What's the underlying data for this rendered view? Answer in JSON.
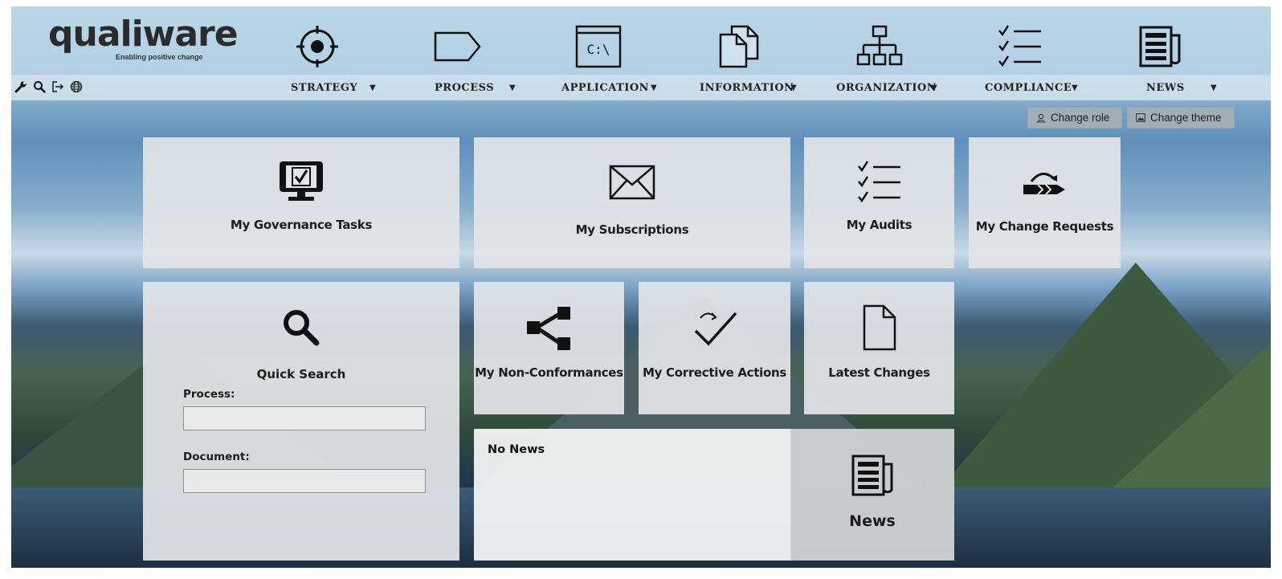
{
  "brand": {
    "name": "qualiware",
    "tagline": "Enabling positive change"
  },
  "toolbar": {
    "icons": [
      "wrench-icon",
      "search-icon",
      "logout-icon",
      "globe-icon"
    ]
  },
  "nav": [
    {
      "label": "STRATEGY",
      "icon": "target-icon"
    },
    {
      "label": "PROCESS",
      "icon": "process-tag-icon"
    },
    {
      "label": "APPLICATION",
      "icon": "terminal-window-icon"
    },
    {
      "label": "INFORMATION",
      "icon": "documents-icon"
    },
    {
      "label": "ORGANIZATION",
      "icon": "org-chart-icon"
    },
    {
      "label": "COMPLIANCE",
      "icon": "checklist-icon"
    },
    {
      "label": "NEWS",
      "icon": "newspaper-icon"
    }
  ],
  "application_icon_text": "C:\\",
  "header_buttons": {
    "change_role": "Change role",
    "change_theme": "Change theme"
  },
  "tiles": {
    "governance": "My Governance Tasks",
    "subscriptions": "My Subscriptions",
    "audits": "My Audits",
    "change_requests": "My Change Requests",
    "non_conformances": "My Non-Conformances",
    "corrective_actions": "My Corrective Actions",
    "latest_changes": "Latest Changes"
  },
  "quick_search": {
    "title": "Quick Search",
    "process_label": "Process:",
    "process_value": "",
    "document_label": "Document:",
    "document_value": ""
  },
  "news": {
    "status": "No News",
    "tile_label": "News"
  },
  "colors": {
    "header": "#b9d6e8",
    "tile": "#e2e4e6",
    "button": "#a5afb6"
  }
}
